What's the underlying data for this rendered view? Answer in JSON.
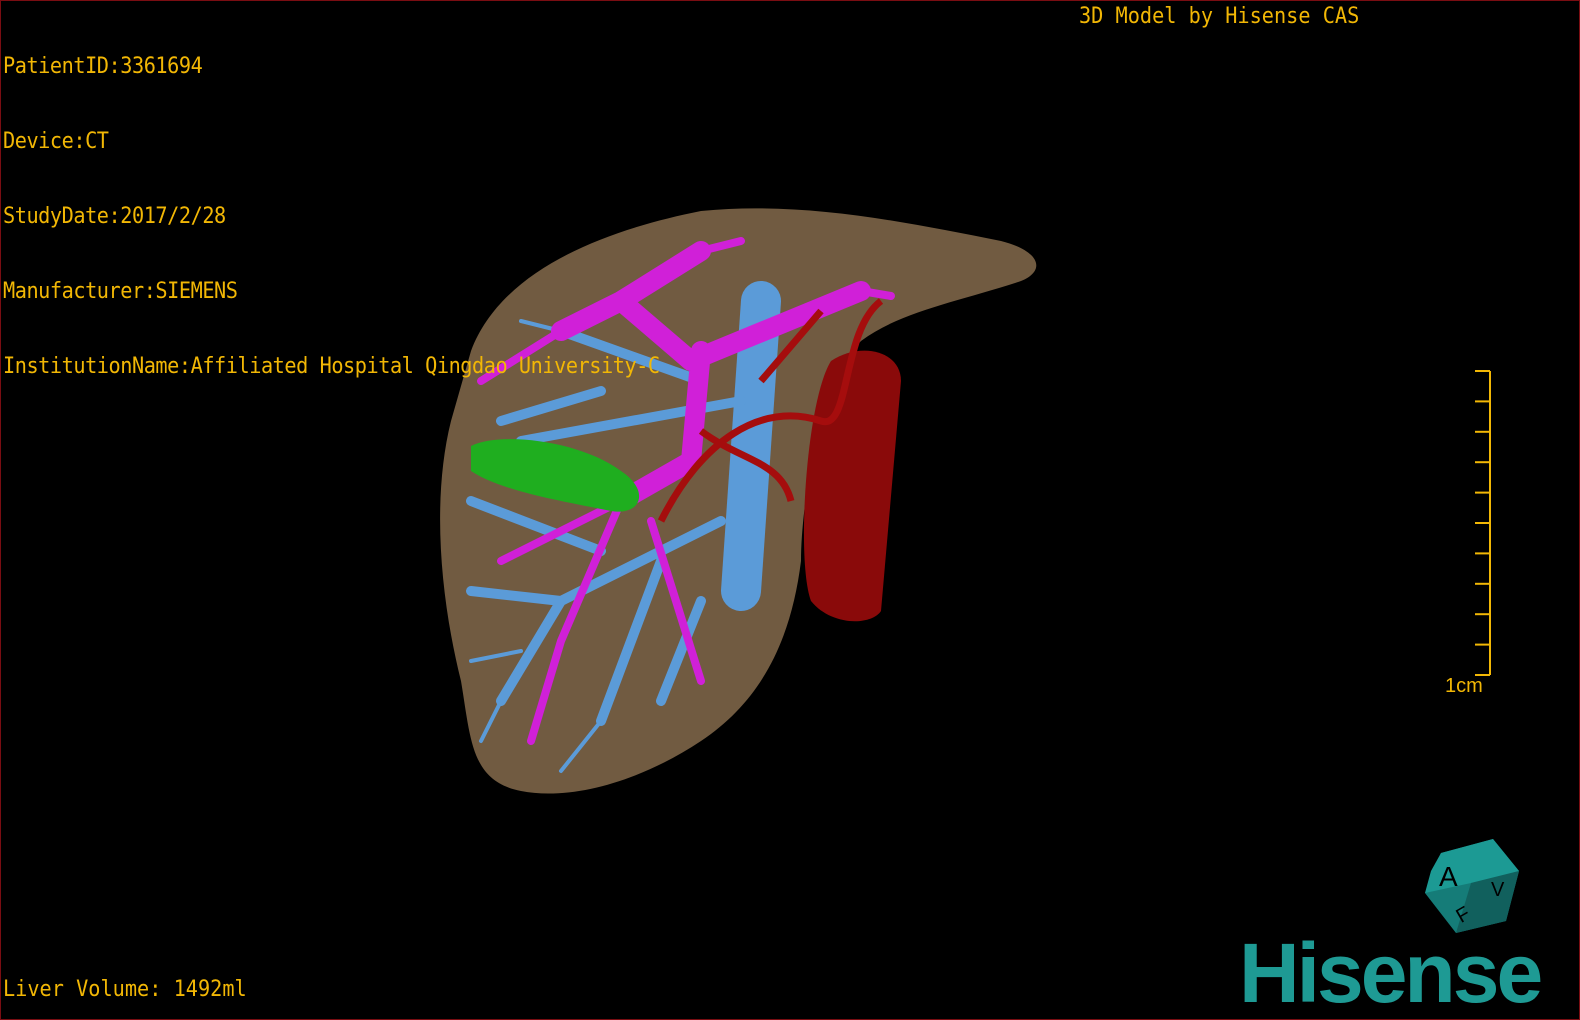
{
  "info": {
    "patient_id": "PatientID:3361694",
    "device": "Device:CT",
    "study_date": "StudyDate:2017/2/28",
    "manufacturer": "Manufacturer:SIEMENS",
    "institution": "InstitutionName:Affiliated Hospital Qingdao University-C"
  },
  "credit": "3D Model by Hisense CAS",
  "volume": "Liver Volume: 1492ml",
  "scale_bar": {
    "label": "1cm",
    "ticks": 10
  },
  "orientation_cube": {
    "faces": [
      "A",
      "F",
      "V"
    ]
  },
  "logo": "Hisense",
  "colors": {
    "text": "#f2b705",
    "liver": "#7d6548",
    "portal_vein": "#d020d8",
    "hepatic_vein": "#5b9bd8",
    "artery": "#9a0b0b",
    "gallbladder": "#1fae1f",
    "logo": "#1e9a94",
    "border": "#7a0d12"
  }
}
